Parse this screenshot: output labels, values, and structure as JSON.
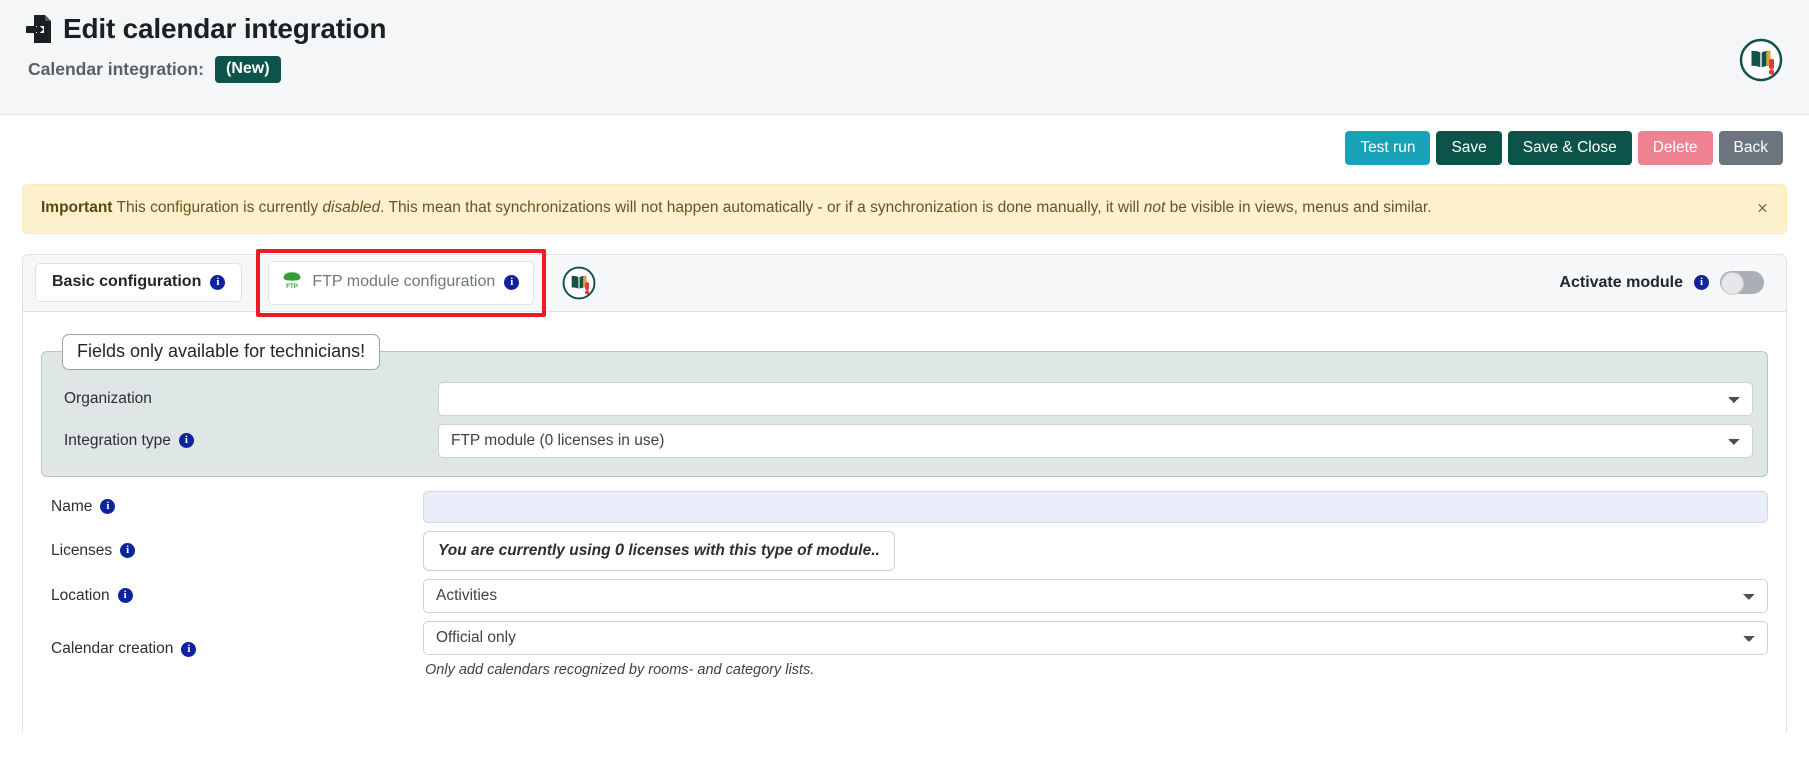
{
  "header": {
    "title": "Edit calendar integration",
    "title_icon": "document-import-icon",
    "subtitle_label": "Calendar integration:",
    "badge": "(New)",
    "book_icon": "book-alert-icon"
  },
  "toolbar": {
    "test_run": "Test run",
    "save": "Save",
    "save_close": "Save & Close",
    "delete": "Delete",
    "back": "Back",
    "colors": {
      "test_run": "#17a2b8",
      "save": "#0c5449",
      "save_close": "#0c5449",
      "delete": "#ee8291",
      "back": "#6c757d"
    }
  },
  "alert": {
    "strong": "Important",
    "part1": " This configuration is currently ",
    "em1": "disabled",
    "part2": ". This mean that synchronizations will not happen automatically - or if a synchronization is done manually, it will ",
    "em2": "not",
    "part3": " be visible in views, menus and similar.",
    "close": "×",
    "background": "#fdf0cd"
  },
  "tabs": {
    "basic": "Basic configuration",
    "ftp": "FTP module configuration",
    "ftp_icon": "ftp-cloud-icon",
    "book_icon": "book-alert-icon",
    "highlight_color": "#ed1c24",
    "activate_label": "Activate module",
    "toggle_state": "off"
  },
  "fieldset": {
    "legend": "Fields only available for technicians!",
    "rows": [
      {
        "label": "Organization",
        "has_info": false,
        "value": ""
      },
      {
        "label": "Integration type",
        "has_info": true,
        "value": "FTP module (0 licenses in use)"
      }
    ]
  },
  "form": {
    "name": {
      "label": "Name",
      "value": ""
    },
    "licenses": {
      "label": "Licenses",
      "note_a": "You are currently using ",
      "note_count": "0",
      "note_b": " licenses with this type of module.."
    },
    "location": {
      "label": "Location",
      "value": "Activities"
    },
    "calendar_creation": {
      "label": "Calendar creation",
      "value": "Official only",
      "help": "Only add calendars recognized by rooms- and category lists."
    }
  }
}
